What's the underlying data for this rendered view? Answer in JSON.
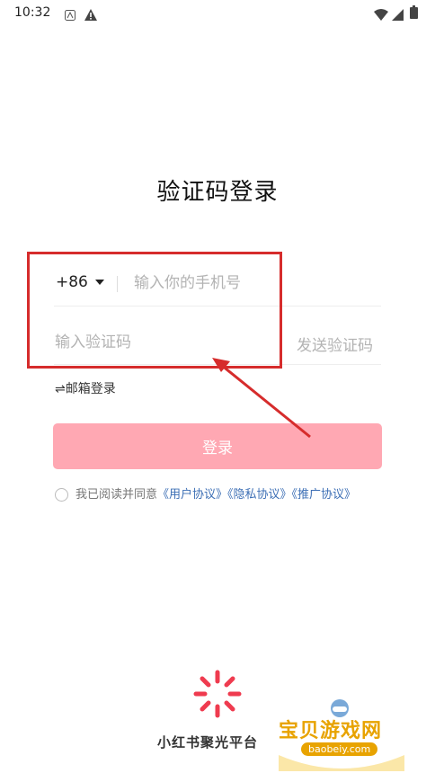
{
  "status_bar": {
    "time": "10:32"
  },
  "title": "验证码登录",
  "form": {
    "country_code": "+86",
    "phone_placeholder": "输入你的手机号",
    "code_placeholder": "输入验证码",
    "send_code_label": "发送验证码",
    "email_login_label": "⇌邮箱登录",
    "login_button": "登录"
  },
  "agreement": {
    "prefix": "我已阅读并同意",
    "links": [
      "《用户协议》",
      "《隐私协议》",
      "《推广协议》"
    ]
  },
  "brand": {
    "name": "小红书聚光平台"
  },
  "watermark": {
    "text": "宝贝游戏网",
    "url": "baobeiy.com"
  },
  "colors": {
    "accent": "#ffa8b3",
    "link": "#3d6fb5",
    "highlight": "#d62c2c"
  }
}
